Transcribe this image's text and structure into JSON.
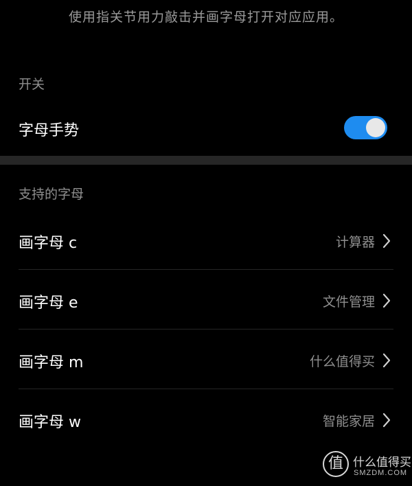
{
  "description": "使用指关节用力敲击并画字母打开对应应用。",
  "switch_section": {
    "label": "开关",
    "toggle": {
      "label": "字母手势",
      "on": true,
      "on_color": "#1e8cf0"
    }
  },
  "letters_section": {
    "label": "支持的字母",
    "items": [
      {
        "title": "画字母 c",
        "value": "计算器"
      },
      {
        "title": "画字母 e",
        "value": "文件管理"
      },
      {
        "title": "画字母 m",
        "value": "什么值得买"
      },
      {
        "title": "画字母 w",
        "value": "智能家居"
      }
    ]
  },
  "icons": {
    "row_chevron": "chevron-right-icon"
  },
  "watermark": {
    "seal_char": "值",
    "text_cn": "什么值得买",
    "text_en": "SMZDM.COM"
  }
}
